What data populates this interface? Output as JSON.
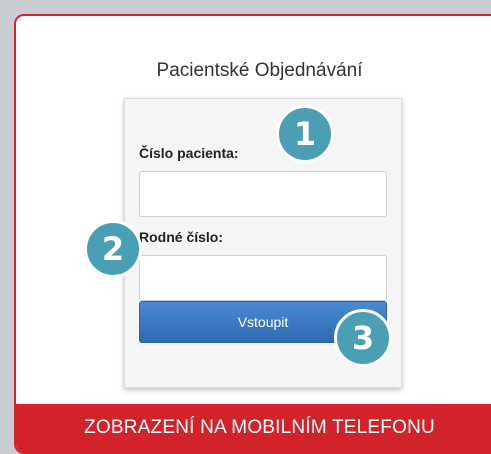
{
  "page": {
    "title": "Pacientské Objednávání"
  },
  "form": {
    "patient_number_label": "Číslo pacienta:",
    "patient_number_value": "",
    "birth_number_label": "Rodné číslo:",
    "birth_number_value": "",
    "submit_label": "Vstoupit"
  },
  "badges": [
    "1",
    "2",
    "3"
  ],
  "footer": {
    "caption": "ZOBRAZENÍ NA MOBILNÍM TELEFONU"
  },
  "colors": {
    "accent_red": "#d2232a",
    "button_blue": "#3578c4",
    "badge_teal": "#4a9fb5"
  }
}
